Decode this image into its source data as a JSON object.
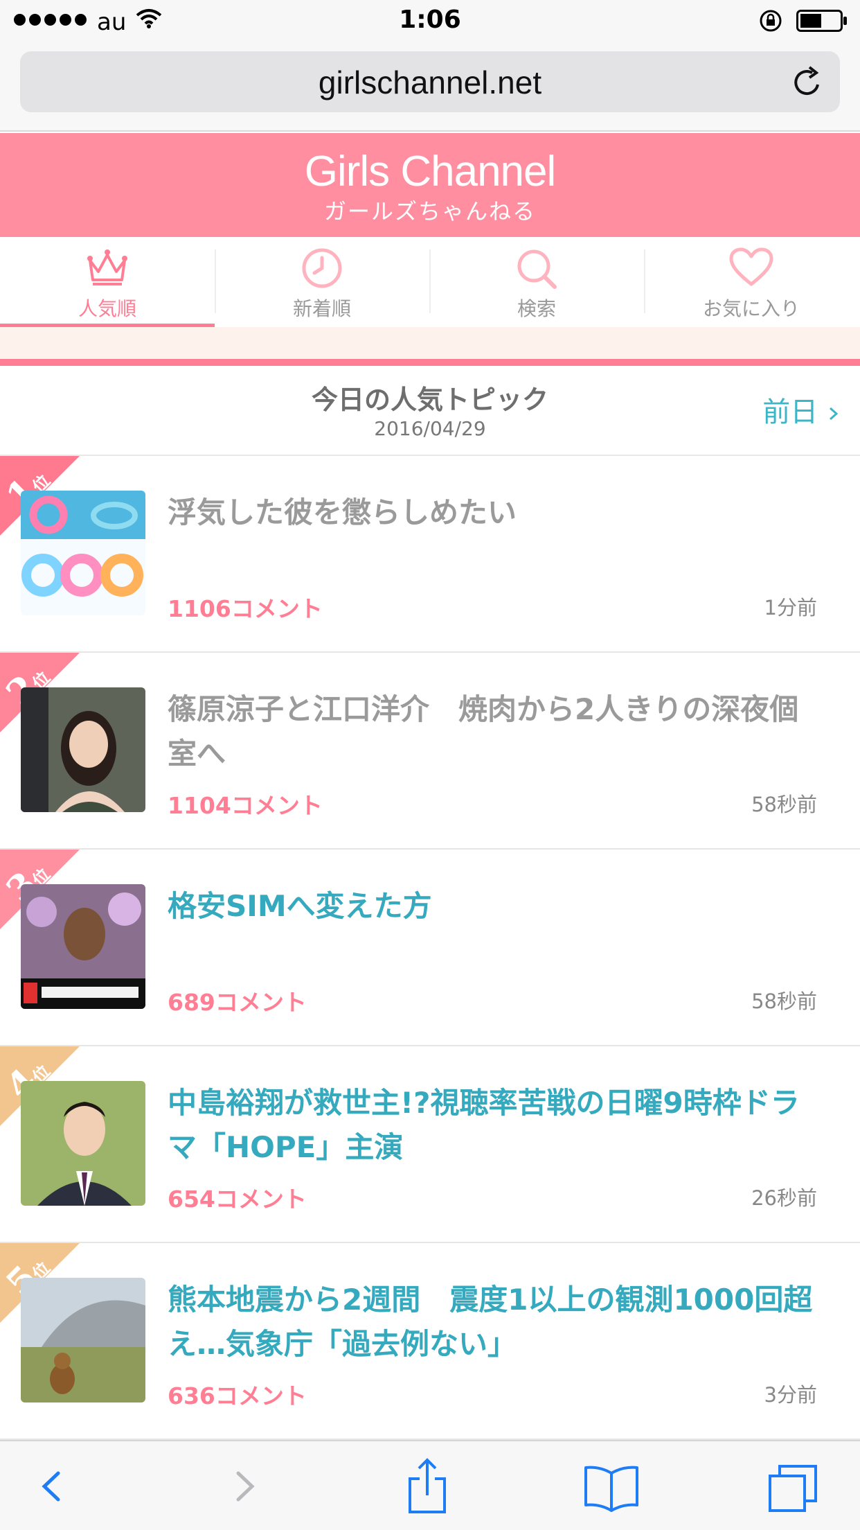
{
  "status_bar": {
    "carrier": "au",
    "time": "1:06"
  },
  "browser": {
    "url": "girlschannel.net"
  },
  "site": {
    "logo_en": "Girls Channel",
    "logo_ja": "ガールズちゃんねる",
    "accent_color": "#ff7e93",
    "link_color": "#35a9bd"
  },
  "tabs": [
    {
      "label": "人気順",
      "icon": "crown-icon",
      "active": true
    },
    {
      "label": "新着順",
      "icon": "clock-icon",
      "active": false
    },
    {
      "label": "検索",
      "icon": "search-icon",
      "active": false
    },
    {
      "label": "お気に入り",
      "icon": "heart-icon",
      "active": false
    }
  ],
  "section": {
    "title": "今日の人気トピック",
    "date": "2016/04/29",
    "prev_label": "前日"
  },
  "topics": [
    {
      "rank": "1",
      "rank_suffix": "位",
      "title": "浮気した彼を懲らしめたい",
      "comments": "1106コメント",
      "time": "1分前",
      "visited": true,
      "ribbon_color": "#ff7a8e"
    },
    {
      "rank": "2",
      "rank_suffix": "位",
      "title": "篠原涼子と江口洋介　焼肉から2人きりの深夜個室へ",
      "comments": "1104コメント",
      "time": "58秒前",
      "visited": true,
      "ribbon_color": "#ff8598"
    },
    {
      "rank": "3",
      "rank_suffix": "位",
      "title": "格安SIMへ変えた方",
      "comments": "689コメント",
      "time": "58秒前",
      "visited": false,
      "ribbon_color": "#ff909f"
    },
    {
      "rank": "4",
      "rank_suffix": "位",
      "title": "中島裕翔が救世主!?視聴率苦戦の日曜9時枠ドラマ「HOPE」主演",
      "comments": "654コメント",
      "time": "26秒前",
      "visited": false,
      "ribbon_color": "#f2c48e"
    },
    {
      "rank": "5",
      "rank_suffix": "位",
      "title": "熊本地震から2週間　震度1以上の観測1000回超え…気象庁「過去例ない」",
      "comments": "636コメント",
      "time": "3分前",
      "visited": false,
      "ribbon_color": "#f2c48e"
    }
  ],
  "toolbar": {
    "items": [
      "back-icon",
      "forward-icon",
      "share-icon",
      "bookmarks-icon",
      "tabs-icon"
    ]
  }
}
